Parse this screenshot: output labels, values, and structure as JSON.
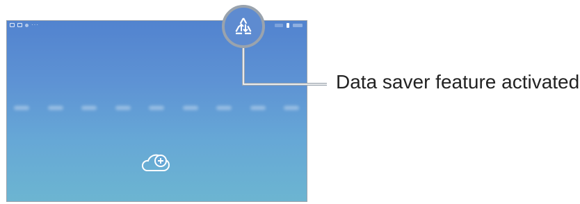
{
  "callout": {
    "text": "Data saver feature activated"
  },
  "statusbar": {
    "left_icons": [
      "notification-icon",
      "gallery-icon",
      "dot-icon",
      "more-icon"
    ],
    "more_glyph": "···",
    "right_icons": [
      "signal-icon",
      "battery-icon"
    ]
  },
  "zoomed_icon": {
    "name": "data-saver-icon"
  },
  "home_screen": {
    "center_icon": "cloud-add-icon"
  },
  "colors": {
    "screen_top": "#5283cf",
    "screen_bottom": "#6cb5d1",
    "frame": "#9aa3ad",
    "callout_text": "#222222"
  }
}
